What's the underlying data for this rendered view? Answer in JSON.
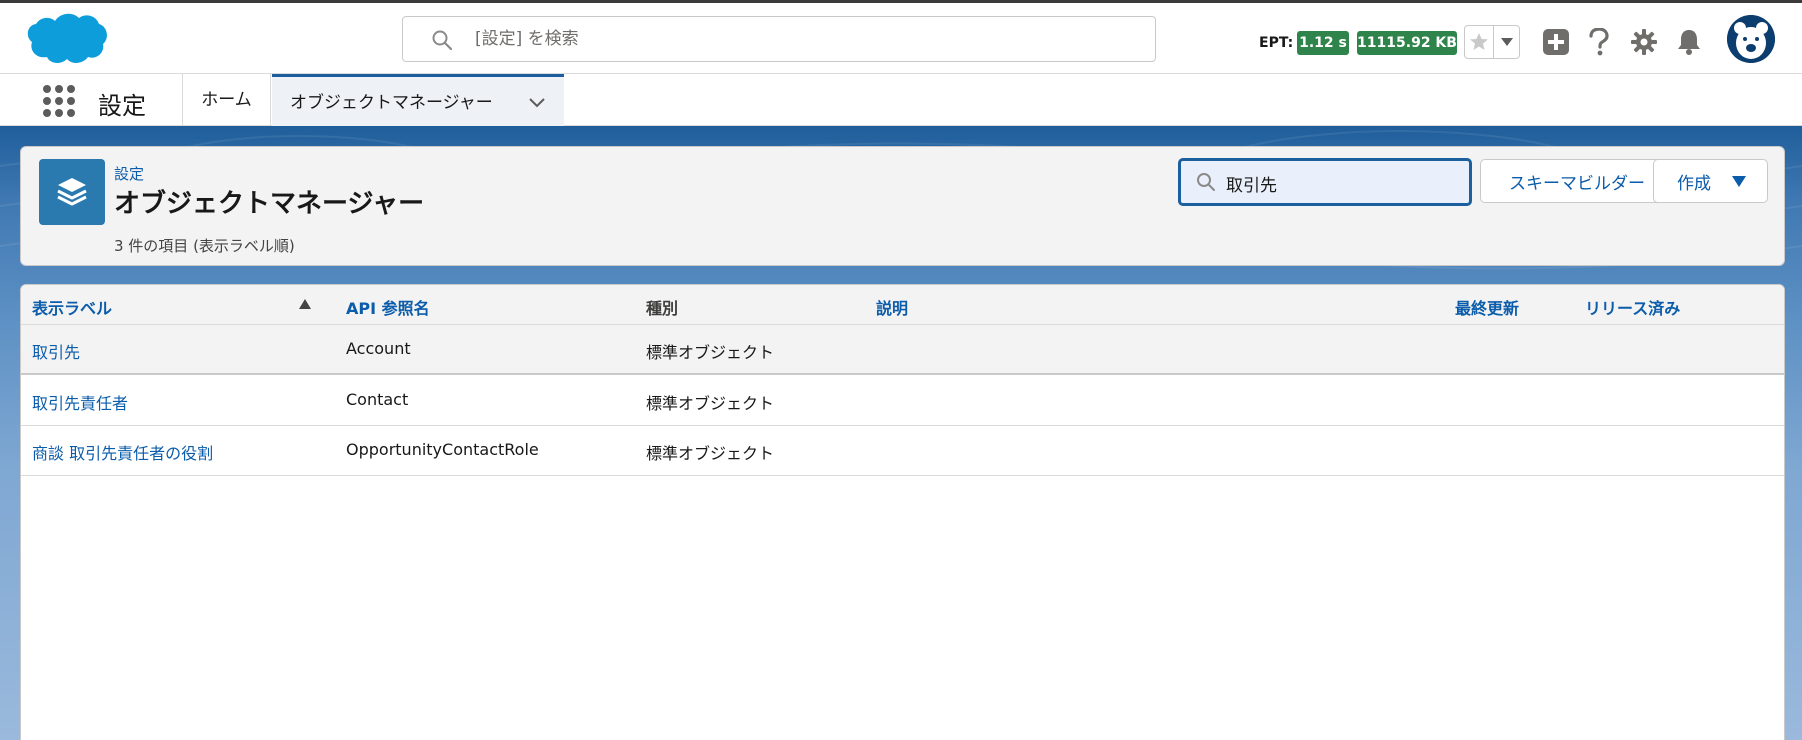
{
  "global_search": {
    "placeholder": "[設定] を検索"
  },
  "ept": {
    "label": "EPT:",
    "time": "1.12 s",
    "size": "11115.92 KB"
  },
  "context_nav": {
    "app_name": "設定",
    "items": [
      {
        "label": "ホーム"
      },
      {
        "label": "オブジェクトマネージャー"
      }
    ]
  },
  "page_header": {
    "breadcrumb": "設定",
    "title": "オブジェクトマネージャー",
    "item_count": "3 件の項目 (表示ラベル順)",
    "quick_find_value": "取引先",
    "schema_builder_label": "スキーマビルダー",
    "create_label": "作成"
  },
  "table": {
    "columns": [
      "表示ラベル",
      "API 参照名",
      "種別",
      "説明",
      "最終更新",
      "リリース済み"
    ],
    "rows": [
      {
        "label": "取引先",
        "api_name": "Account",
        "type": "標準オブジェクト",
        "description": "",
        "last_modified": "",
        "deployed": ""
      },
      {
        "label": "取引先責任者",
        "api_name": "Contact",
        "type": "標準オブジェクト",
        "description": "",
        "last_modified": "",
        "deployed": ""
      },
      {
        "label": "商談 取引先責任者の役割",
        "api_name": "OpportunityContactRole",
        "type": "標準オブジェクト",
        "description": "",
        "last_modified": "",
        "deployed": ""
      }
    ]
  },
  "colors": {
    "brand_blue": "#1b5f9e",
    "link_blue": "#0b5cab",
    "ept_green": "#2e844a",
    "object_icon_blue": "#2a7ab0",
    "logo_blue": "#0d9dda"
  },
  "icons": [
    "salesforce-logo",
    "search-icon",
    "star-icon",
    "chevron-down-icon",
    "plus-icon",
    "help-icon",
    "gear-icon",
    "bell-icon",
    "avatar",
    "app-launcher-icon",
    "layers-icon",
    "sort-ascending-icon",
    "caret-down-icon"
  ]
}
